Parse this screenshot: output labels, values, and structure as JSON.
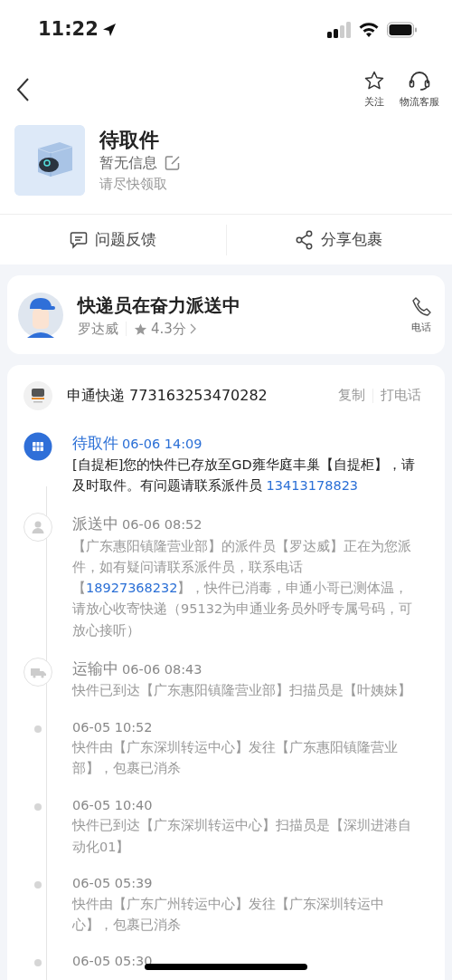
{
  "status_bar": {
    "time": "11:22"
  },
  "nav": {
    "actions": [
      {
        "label": "关注",
        "kind": "star"
      },
      {
        "label": "物流客服",
        "kind": "headset"
      }
    ]
  },
  "package": {
    "title": "待取件",
    "note": "暂无信息",
    "hint": "请尽快领取"
  },
  "actions": [
    {
      "label": "问题反馈",
      "kind": "feedback"
    },
    {
      "label": "分享包裹",
      "kind": "share"
    }
  ],
  "courier": {
    "headline": "快递员在奋力派送中",
    "name": "罗达威",
    "rating": "4.3分",
    "call_label": "电话"
  },
  "tracking": {
    "carrier": "申通快递",
    "number": "773163253470282",
    "links": [
      "复制",
      "打电话"
    ],
    "events": [
      {
        "kind": "locker",
        "active": true,
        "status": "待取件",
        "time": "06-06 14:09",
        "segments": [
          {
            "text": "[自提柜]您的快件已存放至GD雍华庭丰巢【自提柜】，请及时取件。有问题请联系派件员 ",
            "link": false
          },
          {
            "text": "13413178823",
            "link": true
          }
        ]
      },
      {
        "kind": "person",
        "active": false,
        "status": "派送中",
        "time": "06-06 08:52",
        "segments": [
          {
            "text": "【广东惠阳镇隆营业部】的派件员【罗达威】正在为您派件，如有疑问请联系派件员，联系电话【",
            "link": false
          },
          {
            "text": "18927368232",
            "link": true
          },
          {
            "text": "】，快件已消毒，申通小哥已测体温，请放心收寄快递（95132为申通业务员外呼专属号码，可放心接听）",
            "link": false
          }
        ]
      },
      {
        "kind": "truck",
        "active": false,
        "status": "运输中",
        "time": "06-06 08:43",
        "segments": [
          {
            "text": "快件已到达【广东惠阳镇隆营业部】扫描员是【叶姨妹】",
            "link": false
          }
        ]
      },
      {
        "kind": "dot",
        "active": false,
        "time": "06-05 10:52",
        "segments": [
          {
            "text": "快件由【广东深圳转运中心】发往【广东惠阳镇隆营业部】，包裹已消杀",
            "link": false
          }
        ]
      },
      {
        "kind": "dot",
        "active": false,
        "time": "06-05 10:40",
        "segments": [
          {
            "text": "快件已到达【广东深圳转运中心】扫描员是【深圳进港自动化01】",
            "link": false
          }
        ]
      },
      {
        "kind": "dot",
        "active": false,
        "time": "06-05 05:39",
        "segments": [
          {
            "text": "快件由【广东广州转运中心】发往【广东深圳转运中心】，包裹已消杀",
            "link": false
          }
        ]
      },
      {
        "kind": "dot",
        "active": false,
        "time": "06-05 05:30"
      }
    ]
  }
}
